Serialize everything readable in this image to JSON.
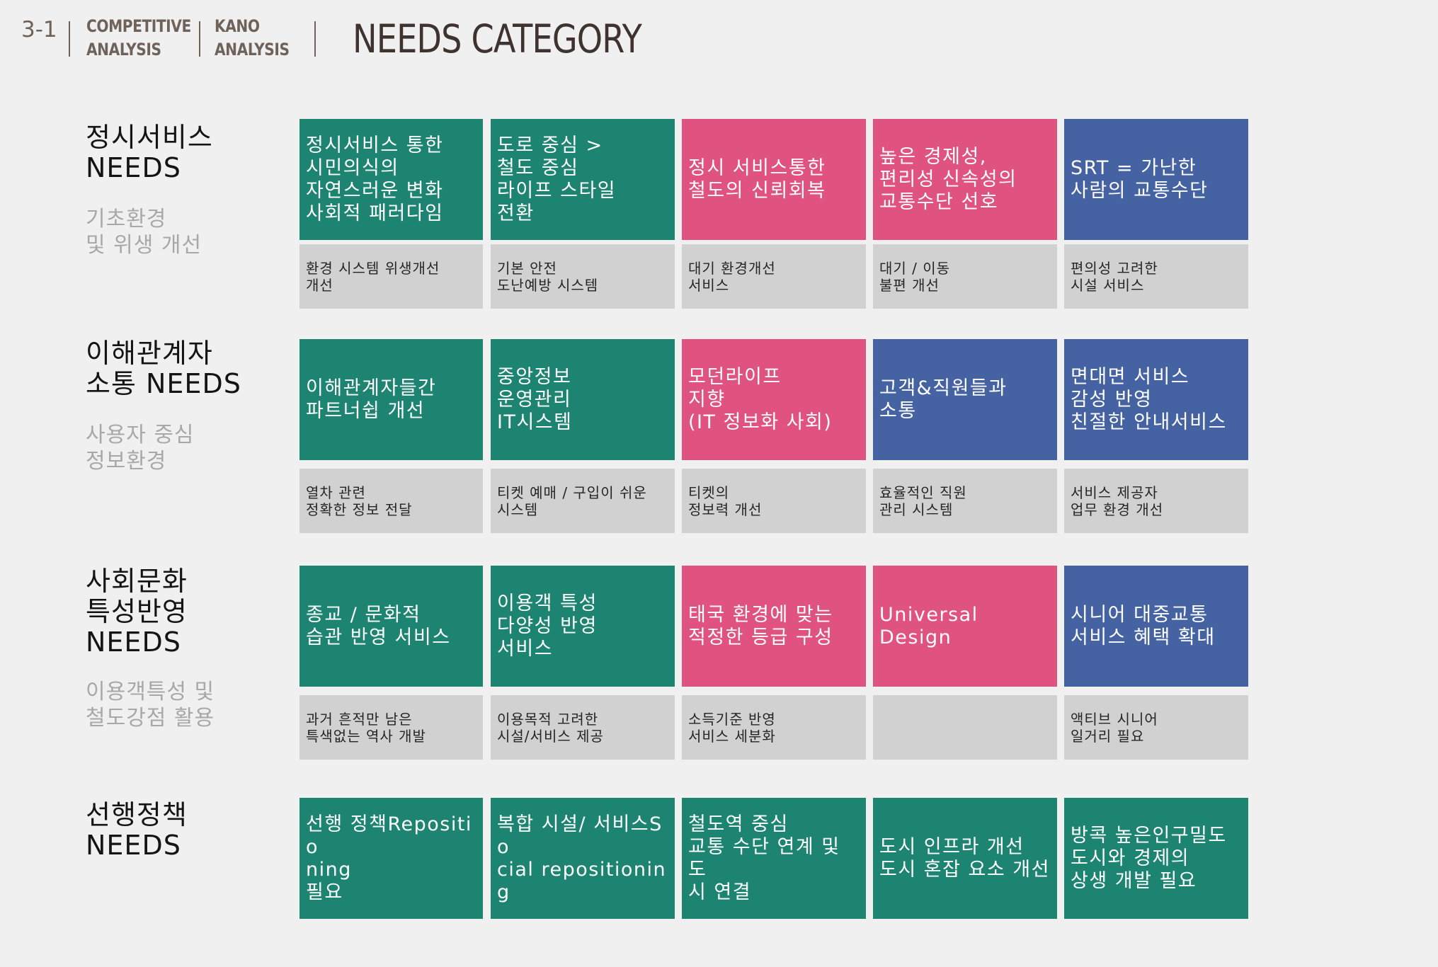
{
  "header": {
    "section_number": "3-1",
    "nav1_line1": "COMPETITIVE",
    "nav1_line2": "ANALYSIS",
    "nav2_line1": "KANO",
    "nav2_line2": "ANALYSIS",
    "title": "NEEDS CATEGORY"
  },
  "colors": {
    "green": "#1d8472",
    "pink": "#e0527f",
    "blue": "#4562a3",
    "gray_cell": "#d1d1d1",
    "background": "#f1f0f0"
  },
  "rows": [
    {
      "title": "정시서비스\nNEEDS",
      "subtitle": "기초환경\n및 위생 개선",
      "cells": [
        {
          "text": "정시서비스 통한\n시민의식의\n자연스러운 변화\n사회적 패러다임",
          "color": "green",
          "sub": "환경 시스템  위생개선\n개선"
        },
        {
          "text": "도로 중심 >\n철도 중심\n라이프 스타일\n전환",
          "color": "green",
          "sub": "기본 안전\n도난예방 시스템"
        },
        {
          "text": "정시 서비스통한\n철도의 신뢰회복",
          "color": "pink",
          "sub": "대기 환경개선\n서비스"
        },
        {
          "text": "높은 경제성,\n편리성 신속성의\n교통수단 선호",
          "color": "pink",
          "sub": "대기 / 이동\n불편 개선"
        },
        {
          "text": "SRT = 가난한\n사람의 교통수단",
          "color": "blue",
          "sub": "편의성 고려한\n시설 서비스"
        }
      ]
    },
    {
      "title": "이해관계자\n소통 NEEDS",
      "subtitle": "사용자 중심\n정보환경",
      "cells": [
        {
          "text": "이해관계자들간\n파트너쉽 개선",
          "color": "green",
          "sub": "열차 관련\n정확한 정보 전달"
        },
        {
          "text": "중앙정보\n운영관리\nIT시스템",
          "color": "green",
          "sub": "티켓 예매 / 구입이 쉬운\n시스템"
        },
        {
          "text": "모던라이프\n지향\n(IT 정보화 사회)",
          "color": "pink",
          "sub": "티켓의\n정보력 개선"
        },
        {
          "text": "고객&직원들과\n소통",
          "color": "blue",
          "sub": "효율적인 직원\n관리 시스템"
        },
        {
          "text": "면대면 서비스\n감성 반영\n친절한 안내서비스",
          "color": "blue",
          "sub": "서비스 제공자\n업무 환경 개선"
        }
      ]
    },
    {
      "title": "사회문화\n특성반영\nNEEDS",
      "subtitle": "이용객특성 및\n철도강점 활용",
      "cells": [
        {
          "text": "종교 / 문화적\n습관 반영 서비스",
          "color": "green",
          "sub": "과거 흔적만 남은\n특색없는 역사 개발"
        },
        {
          "text": "이용객 특성\n다양성 반영\n서비스",
          "color": "green",
          "sub": "이용목적 고려한\n시설/서비스 제공"
        },
        {
          "text": "태국 환경에 맞는\n적정한 등급 구성",
          "color": "pink",
          "sub": "소득기준 반영\n서비스 세분화"
        },
        {
          "text": "Universal\nDesign",
          "color": "pink",
          "sub": ""
        },
        {
          "text": "시니어 대중교통\n서비스 혜택 확대",
          "color": "blue",
          "sub": "액티브 시니어\n일거리 필요"
        }
      ]
    },
    {
      "title": "선행정책\nNEEDS",
      "subtitle": "",
      "cells": [
        {
          "text": "선행 정책Repositio\nning\n필요",
          "color": "green"
        },
        {
          "text": "복합 시설/ 서비스So\ncial repositioning",
          "color": "green"
        },
        {
          "text": "철도역 중심\n교통 수단 연계 및 도\n시 연결",
          "color": "green"
        },
        {
          "text": "도시 인프라 개선\n도시 혼잡 요소 개선",
          "color": "green"
        },
        {
          "text": "방콕 높은인구밀도\n도시와 경제의\n상생 개발 필요",
          "color": "green"
        }
      ]
    }
  ]
}
